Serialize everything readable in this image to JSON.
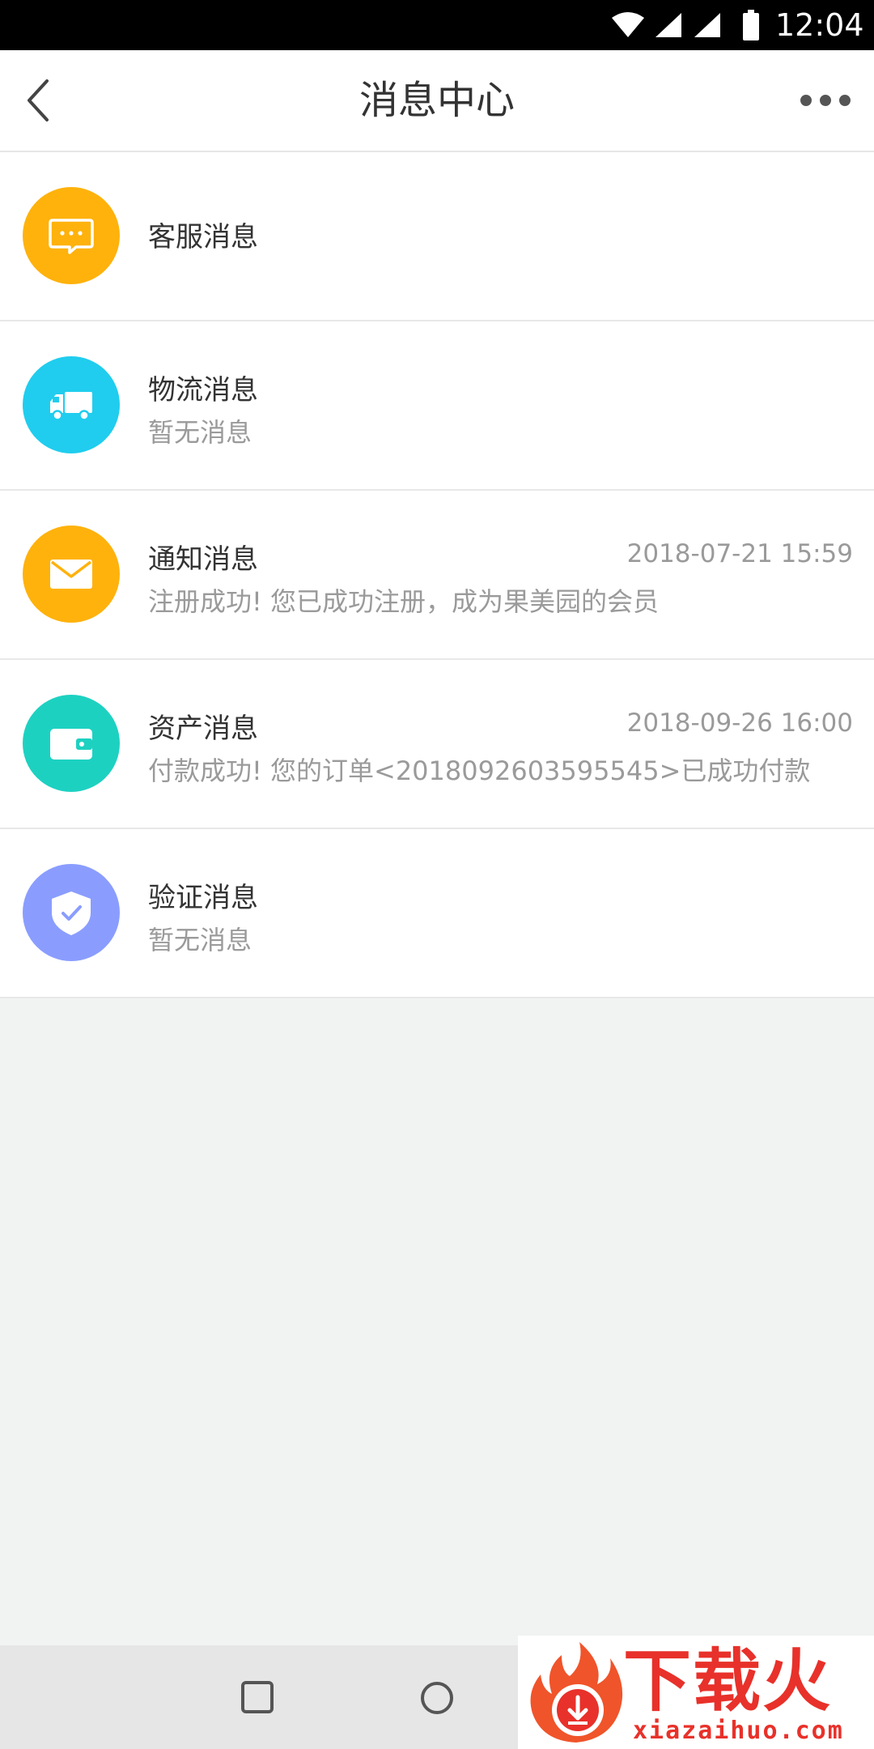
{
  "status_bar": {
    "time": "12:04",
    "icons": [
      "wifi-icon",
      "signal-icon",
      "signal-icon",
      "battery-icon"
    ]
  },
  "header": {
    "title": "消息中心",
    "back_icon": "chevron-left-icon",
    "more_icon": "more-horizontal-icon"
  },
  "messages": [
    {
      "icon": "chat-bubble-icon",
      "color": "#ffb20c",
      "title": "客服消息",
      "subtitle": "",
      "time": ""
    },
    {
      "icon": "truck-icon",
      "color": "#20cdee",
      "title": "物流消息",
      "subtitle": "暂无消息",
      "time": ""
    },
    {
      "icon": "envelope-icon",
      "color": "#ffb20c",
      "title": "通知消息",
      "subtitle": "注册成功! 您已成功注册，成为果美园的会员",
      "time": "2018-07-21 15:59"
    },
    {
      "icon": "wallet-icon",
      "color": "#1dd1c1",
      "title": "资产消息",
      "subtitle": "付款成功! 您的订单<2018092603595545>已成功付款",
      "time": "2018-09-26 16:00"
    },
    {
      "icon": "shield-check-icon",
      "color": "#8a9dff",
      "title": "验证消息",
      "subtitle": "暂无消息",
      "time": ""
    }
  ],
  "nav_bar": {
    "buttons": [
      "recents-button",
      "home-button"
    ]
  },
  "watermark": {
    "name": "下载火",
    "url": "xiazaihuo.com"
  }
}
